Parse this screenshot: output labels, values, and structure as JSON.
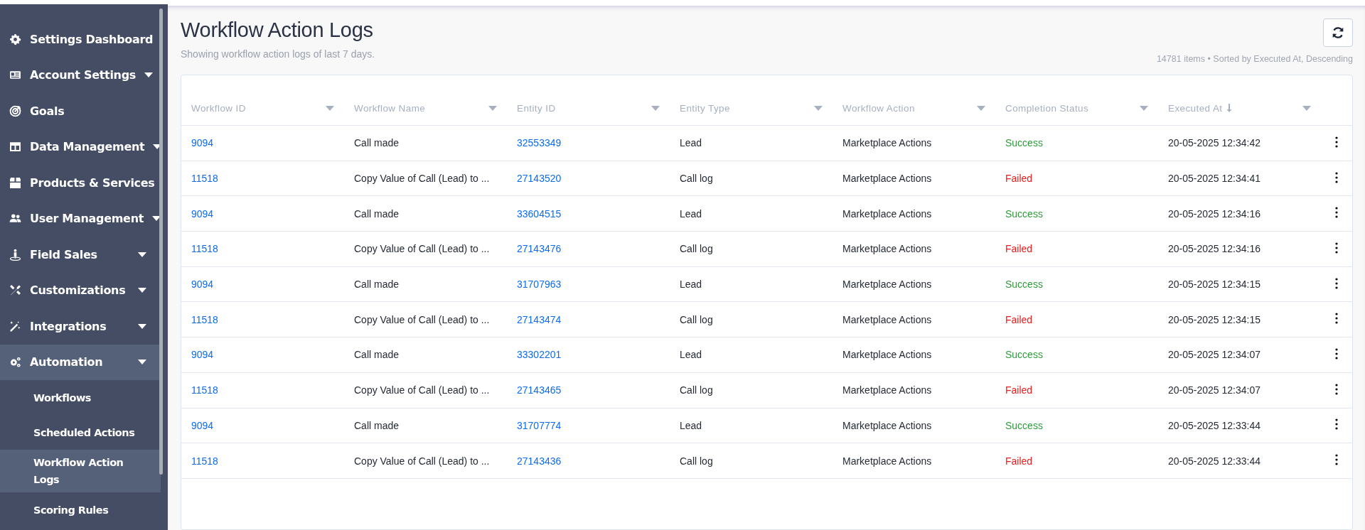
{
  "sidebar": {
    "items": [
      {
        "label": "Settings Dashboard",
        "expandable": false,
        "selected": false
      },
      {
        "label": "Account Settings",
        "expandable": true,
        "selected": false
      },
      {
        "label": "Goals",
        "expandable": false,
        "selected": false
      },
      {
        "label": "Data Management",
        "expandable": true,
        "selected": false
      },
      {
        "label": "Products & Services",
        "expandable": false,
        "selected": false
      },
      {
        "label": "User Management",
        "expandable": true,
        "selected": false
      },
      {
        "label": "Field Sales",
        "expandable": true,
        "selected": false
      },
      {
        "label": "Customizations",
        "expandable": true,
        "selected": false
      },
      {
        "label": "Integrations",
        "expandable": true,
        "selected": false
      },
      {
        "label": "Automation",
        "expandable": true,
        "selected": true,
        "children": [
          {
            "label": "Workflows",
            "selected": false
          },
          {
            "label": "Scheduled Actions",
            "selected": false
          },
          {
            "label": "Workflow Action Logs",
            "selected": true
          },
          {
            "label": "Scoring Rules",
            "selected": false
          }
        ]
      }
    ]
  },
  "page": {
    "title": "Workflow Action Logs",
    "subtitle": "Showing workflow action logs of last 7 days.",
    "summary": "14781 items • Sorted by Executed At, Descending"
  },
  "table": {
    "columns": [
      {
        "label": "Workflow ID",
        "sorted": false
      },
      {
        "label": "Workflow Name",
        "sorted": false
      },
      {
        "label": "Entity ID",
        "sorted": false
      },
      {
        "label": "Entity Type",
        "sorted": false
      },
      {
        "label": "Workflow Action",
        "sorted": false
      },
      {
        "label": "Completion Status",
        "sorted": false
      },
      {
        "label": "Executed At",
        "sorted": true
      }
    ],
    "rows": [
      {
        "workflow_id": "9094",
        "workflow_name": "Call made",
        "entity_id": "32553349",
        "entity_type": "Lead",
        "workflow_action": "Marketplace Actions",
        "status": {
          "text": "Success",
          "kind": "success"
        },
        "executed_at": "20-05-2025 12:34:42"
      },
      {
        "workflow_id": "11518",
        "workflow_name": "Copy Value of Call (Lead) to ...",
        "entity_id": "27143520",
        "entity_type": "Call log",
        "workflow_action": "Marketplace Actions",
        "status": {
          "text": "Failed",
          "kind": "failed"
        },
        "executed_at": "20-05-2025 12:34:41"
      },
      {
        "workflow_id": "9094",
        "workflow_name": "Call made",
        "entity_id": "33604515",
        "entity_type": "Lead",
        "workflow_action": "Marketplace Actions",
        "status": {
          "text": "Success",
          "kind": "success"
        },
        "executed_at": "20-05-2025 12:34:16"
      },
      {
        "workflow_id": "11518",
        "workflow_name": "Copy Value of Call (Lead) to ...",
        "entity_id": "27143476",
        "entity_type": "Call log",
        "workflow_action": "Marketplace Actions",
        "status": {
          "text": "Failed",
          "kind": "failed"
        },
        "executed_at": "20-05-2025 12:34:16"
      },
      {
        "workflow_id": "9094",
        "workflow_name": "Call made",
        "entity_id": "31707963",
        "entity_type": "Lead",
        "workflow_action": "Marketplace Actions",
        "status": {
          "text": "Success",
          "kind": "success"
        },
        "executed_at": "20-05-2025 12:34:15"
      },
      {
        "workflow_id": "11518",
        "workflow_name": "Copy Value of Call (Lead) to ...",
        "entity_id": "27143474",
        "entity_type": "Call log",
        "workflow_action": "Marketplace Actions",
        "status": {
          "text": "Failed",
          "kind": "failed"
        },
        "executed_at": "20-05-2025 12:34:15"
      },
      {
        "workflow_id": "9094",
        "workflow_name": "Call made",
        "entity_id": "33302201",
        "entity_type": "Lead",
        "workflow_action": "Marketplace Actions",
        "status": {
          "text": "Success",
          "kind": "success"
        },
        "executed_at": "20-05-2025 12:34:07"
      },
      {
        "workflow_id": "11518",
        "workflow_name": "Copy Value of Call (Lead) to ...",
        "entity_id": "27143465",
        "entity_type": "Call log",
        "workflow_action": "Marketplace Actions",
        "status": {
          "text": "Failed",
          "kind": "failed"
        },
        "executed_at": "20-05-2025 12:34:07"
      },
      {
        "workflow_id": "9094",
        "workflow_name": "Call made",
        "entity_id": "31707774",
        "entity_type": "Lead",
        "workflow_action": "Marketplace Actions",
        "status": {
          "text": "Success",
          "kind": "success"
        },
        "executed_at": "20-05-2025 12:33:44"
      },
      {
        "workflow_id": "11518",
        "workflow_name": "Copy Value of Call (Lead) to ...",
        "entity_id": "27143436",
        "entity_type": "Call log",
        "workflow_action": "Marketplace Actions",
        "status": {
          "text": "Failed",
          "kind": "failed"
        },
        "executed_at": "20-05-2025 12:33:44"
      }
    ]
  }
}
